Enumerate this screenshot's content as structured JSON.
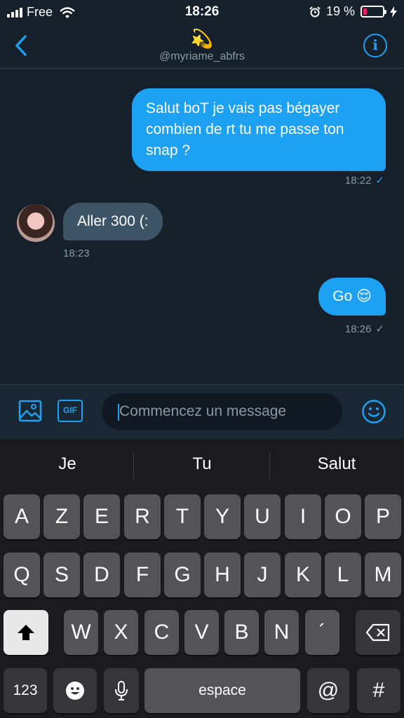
{
  "status": {
    "carrier": "Free",
    "time": "18:26",
    "battery_pct": "19 %",
    "battery_level": 0.19
  },
  "header": {
    "emoji": "💫",
    "handle": "@myriame_abfrs",
    "info_label": "i"
  },
  "messages": [
    {
      "text": "Salut boT je vais pas bégayer combien de rt tu me passe ton snap ?",
      "time": "18:22",
      "check": "✓"
    },
    {
      "text": "Aller 300 (:",
      "time": "18:23"
    },
    {
      "text": "Go 😌",
      "time": "18:26",
      "check": "✓"
    }
  ],
  "composer": {
    "gif_label": "GIF",
    "placeholder": "Commencez un message"
  },
  "suggestions": [
    "Je",
    "Tu",
    "Salut"
  ],
  "keys": {
    "row1": [
      "A",
      "Z",
      "E",
      "R",
      "T",
      "Y",
      "U",
      "I",
      "O",
      "P"
    ],
    "row2": [
      "Q",
      "S",
      "D",
      "F",
      "G",
      "H",
      "J",
      "K",
      "L",
      "M"
    ],
    "row3": [
      "W",
      "X",
      "C",
      "V",
      "B",
      "N",
      "´"
    ],
    "numbers": "123",
    "space": "espace",
    "at": "@",
    "hash": "#"
  },
  "colors": {
    "accent": "#1da1f2",
    "background": "#15202b",
    "received_bubble": "#3d5466"
  }
}
